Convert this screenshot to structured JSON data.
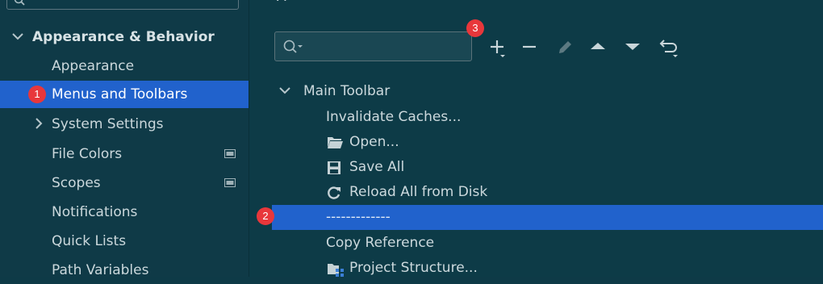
{
  "sidebar": {
    "group": {
      "label": "Appearance & Behavior",
      "expanded": true
    },
    "items": [
      {
        "label": "Appearance",
        "selected": false
      },
      {
        "label": "Menus and Toolbars",
        "selected": true,
        "badge": "1"
      },
      {
        "label": "System Settings",
        "collapsed": true
      },
      {
        "label": "File Colors",
        "project_icon": true
      },
      {
        "label": "Scopes",
        "project_icon": true
      },
      {
        "label": "Notifications"
      },
      {
        "label": "Quick Lists"
      },
      {
        "label": "Path Variables"
      }
    ]
  },
  "main": {
    "title_fragment": "A",
    "toolbar_badge": "3",
    "search": {
      "value": "",
      "placeholder": ""
    },
    "tools": [
      "add-icon",
      "remove-icon",
      "edit-icon",
      "move-up-icon",
      "move-down-icon",
      "restore-icon"
    ],
    "tree": {
      "root": {
        "label": "Main Toolbar",
        "expanded": true
      },
      "items": [
        {
          "label": "Invalidate Caches...",
          "icon": ""
        },
        {
          "label": "Open...",
          "icon": "folder-icon"
        },
        {
          "label": "Save All",
          "icon": "save-icon"
        },
        {
          "label": "Reload All from Disk",
          "icon": "reload-icon"
        },
        {
          "label": "-------------",
          "icon": "",
          "selected": true,
          "badge": "2"
        },
        {
          "label": "Copy Reference",
          "icon": ""
        },
        {
          "label": "Project Structure...",
          "icon": "project-structure-icon"
        }
      ]
    }
  },
  "colors": {
    "background": "#0e3a47",
    "selection": "#2162cc",
    "badge": "#e8373b",
    "text": "#cbd8dc"
  }
}
